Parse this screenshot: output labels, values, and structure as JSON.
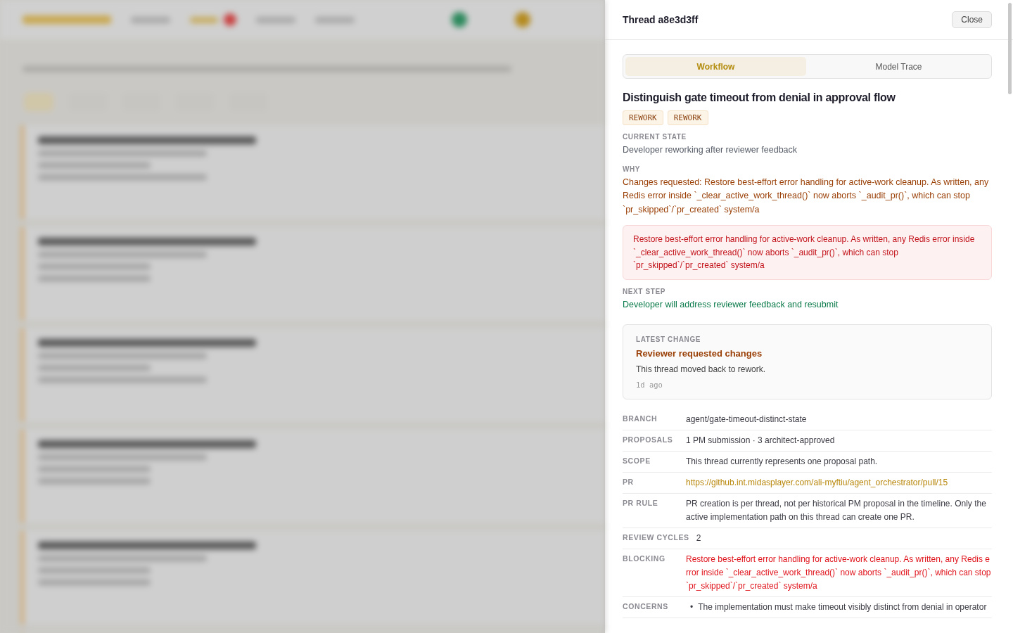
{
  "panel": {
    "title": "Thread a8e3d3ff",
    "close_label": "Close",
    "tabs": [
      {
        "label": "Workflow",
        "selected": true
      },
      {
        "label": "Model Trace",
        "selected": false
      }
    ],
    "thread_title": "Distinguish gate timeout from denial in approval flow",
    "tags": [
      "REWORK",
      "REWORK"
    ],
    "current_state": {
      "label": "CURRENT STATE",
      "text": "Developer reworking after reviewer feedback"
    },
    "why": {
      "label": "WHY",
      "text": "Changes requested: Restore best-effort error handling for active-work cleanup. As written, any Redis error inside `_clear_active_work_thread()` now aborts `_audit_pr()`, which can stop `pr_skipped`/`pr_created` system/a"
    },
    "alert": "Restore best-effort error handling for active-work cleanup. As written, any Redis error inside `_clear_active_work_thread()` now aborts `_audit_pr()`, which can stop `pr_skipped`/`pr_created` system/a",
    "next_step": {
      "label": "NEXT STEP",
      "text": "Developer will address reviewer feedback and resubmit"
    },
    "latest_change": {
      "label": "LATEST CHANGE",
      "title": "Reviewer requested changes",
      "text": "This thread moved back to rework.",
      "time": "1d ago"
    },
    "fields": [
      {
        "kind": "text",
        "label": "BRANCH",
        "value": "agent/gate-timeout-distinct-state"
      },
      {
        "kind": "text",
        "label": "PROPOSALS",
        "value": "1 PM submission · 3 architect-approved"
      },
      {
        "kind": "text",
        "label": "SCOPE",
        "value": "This thread currently represents one proposal path."
      },
      {
        "kind": "link",
        "label": "PR",
        "value": "https://github.int.midasplayer.com/ali-myftiu/agent_orchestrator/pull/15"
      },
      {
        "kind": "text",
        "label": "PR RULE",
        "value": "PR creation is per thread, not per historical PM proposal in the timeline. Only the active implementation path on this thread can create one PR."
      },
      {
        "kind": "text",
        "label": "REVIEW CYCLES",
        "value": "2"
      },
      {
        "kind": "blocking",
        "label": "BLOCKING",
        "value": "Restore best-effort error handling for active-work cleanup. As written, any Redis error inside `_clear_active_work_thread()` now aborts `_audit_pr()`, which can stop `pr_skipped`/`pr_created` system/a"
      },
      {
        "kind": "list",
        "label": "CONCERNS",
        "bullet": "•",
        "items": [
          "The implementation must make timeout visibly distinct from denial in operator"
        ]
      }
    ]
  }
}
